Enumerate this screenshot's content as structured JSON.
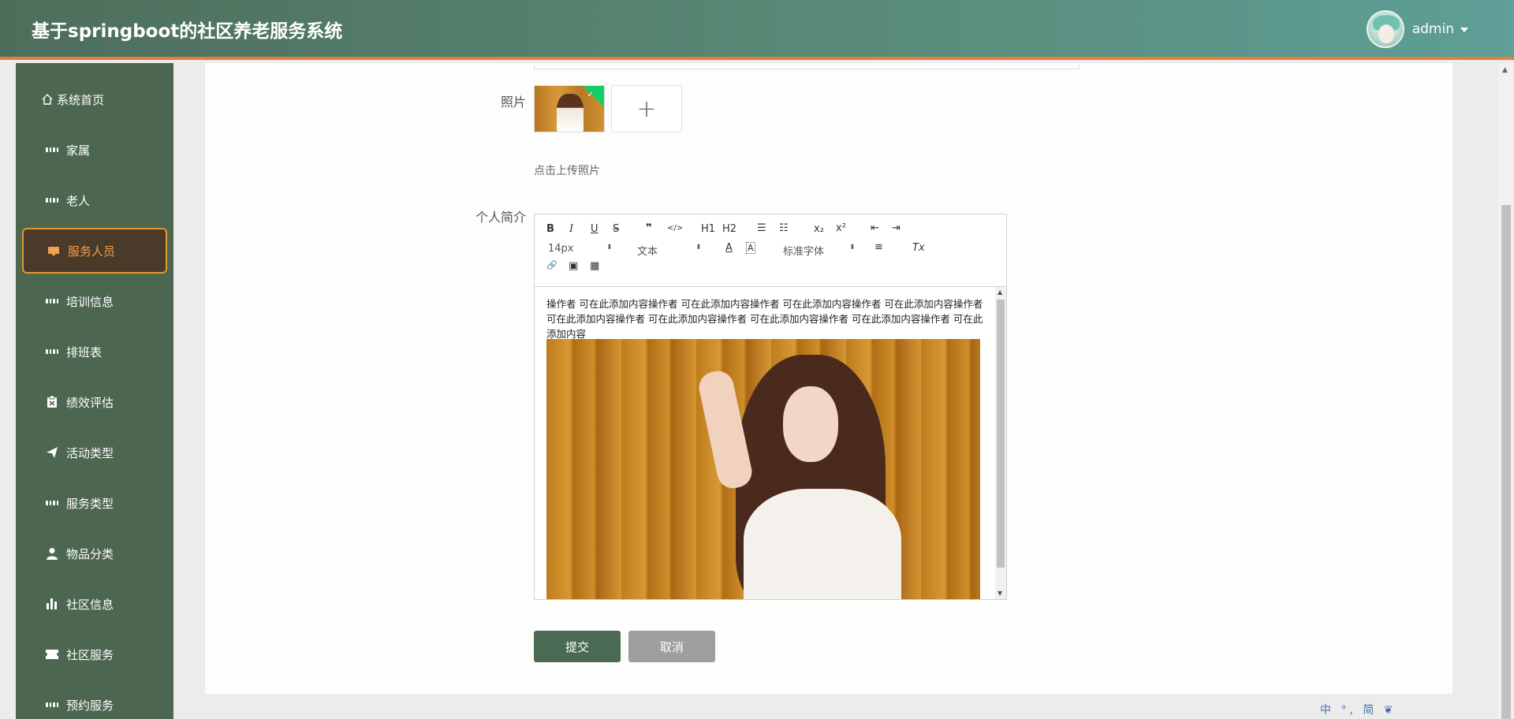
{
  "header": {
    "title": "基于springboot的社区养老服务系统",
    "username": "admin"
  },
  "sidebar": {
    "items": [
      {
        "label": "系统首页",
        "icon": "home-icon"
      },
      {
        "label": "家属",
        "icon": "grid-icon"
      },
      {
        "label": "老人",
        "icon": "grid-icon"
      },
      {
        "label": "服务人员",
        "icon": "monitor-icon",
        "active": true
      },
      {
        "label": "培训信息",
        "icon": "grid-icon"
      },
      {
        "label": "排班表",
        "icon": "grid-icon"
      },
      {
        "label": "绩效评估",
        "icon": "clipboard-icon"
      },
      {
        "label": "活动类型",
        "icon": "paper-plane-icon"
      },
      {
        "label": "服务类型",
        "icon": "grid-icon"
      },
      {
        "label": "物品分类",
        "icon": "user-icon"
      },
      {
        "label": "社区信息",
        "icon": "bar-chart-icon"
      },
      {
        "label": "社区服务",
        "icon": "ticket-icon"
      },
      {
        "label": "预约服务",
        "icon": "grid-icon"
      }
    ]
  },
  "form": {
    "photo_label": "照片",
    "upload_plus": "+",
    "upload_hint": "点击上传照片",
    "intro_label": "个人简介",
    "intro_text": "操作者 可在此添加内容操作者 可在此添加内容操作者 可在此添加内容操作者 可在此添加内容操作者 可在此添加内容操作者 可在此添加内容操作者 可在此添加内容操作者 可在此添加内容操作者 可在此添加内容",
    "submit_label": "提交",
    "cancel_label": "取消"
  },
  "editor_toolbar": {
    "bold": "B",
    "italic": "I",
    "underline": "U",
    "strike": "S",
    "quote": "❞",
    "code": "</>",
    "h1": "H1",
    "h2": "H2",
    "ordered_list": "☰",
    "bullet_list": "☷",
    "subscript": "x₂",
    "superscript": "x²",
    "outdent": "⇤",
    "indent": "⇥",
    "size_value": "14px",
    "type_value": "文本",
    "color": "A",
    "background": "A",
    "font_value": "标准字体",
    "align": "≡",
    "clean": "Tx",
    "link": "🔗",
    "image": "▣",
    "video": "▦"
  },
  "ime": {
    "text": "中 °, 简 ❦"
  },
  "colors": {
    "header_start": "#4d6e5a",
    "header_end": "#5e9f97",
    "accent": "#e67e3a",
    "sidebar_bg": "#4c6650",
    "active_text": "#f1a04b",
    "submit_bg": "#4b6a53",
    "cancel_bg": "#9e9e9e"
  }
}
